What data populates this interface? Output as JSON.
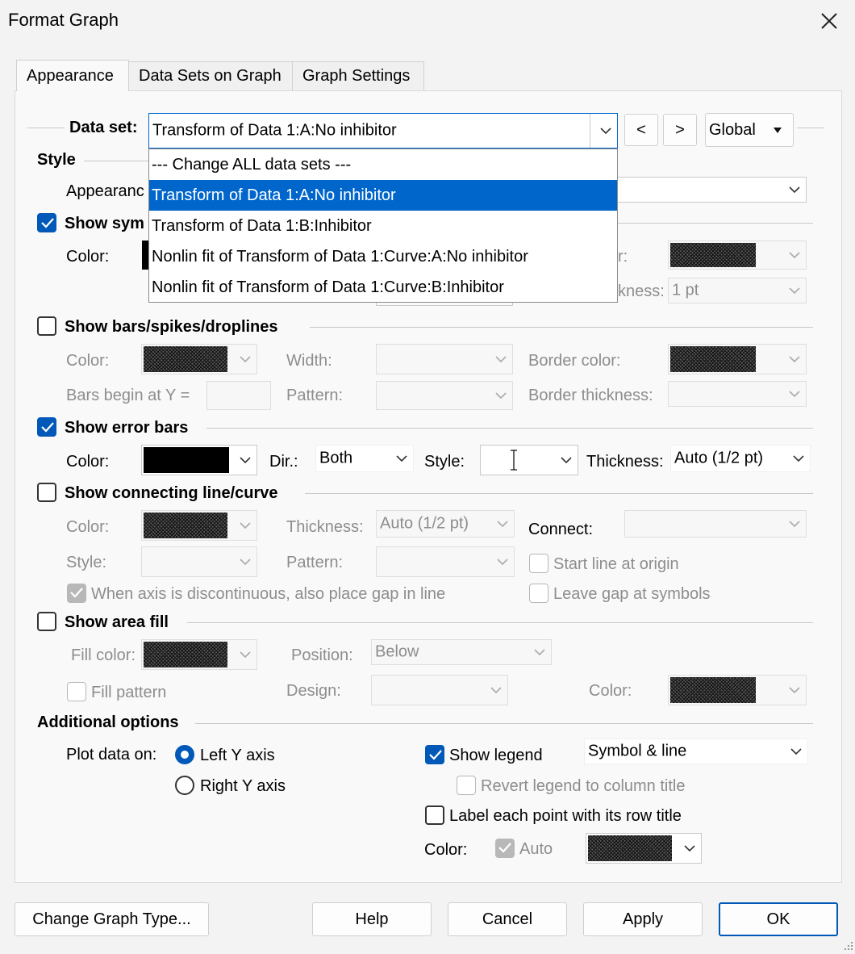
{
  "window": {
    "title": "Format Graph"
  },
  "tabs": [
    "Appearance",
    "Data Sets on Graph",
    "Graph Settings"
  ],
  "dataset": {
    "label": "Data set:",
    "value": "Transform of Data 1:A:No inhibitor",
    "prev": "<",
    "next": ">",
    "scope": "Global",
    "options": [
      "--- Change ALL data sets ---",
      "Transform of Data 1:A:No inhibitor",
      "Transform of Data 1:B:Inhibitor",
      "Nonlin fit of Transform of Data 1:Curve:A:No inhibitor",
      "Nonlin fit of Transform of Data 1:Curve:B:Inhibitor"
    ]
  },
  "style": {
    "header": "Style",
    "appearance_label": "Appearanc",
    "show_symbols": "Show sym",
    "color_label": "Color:",
    "border_color_partial": "r:",
    "thickness_partial": "kness:",
    "thickness_value": "1 pt"
  },
  "bars": {
    "label": "Show bars/spikes/droplines",
    "color": "Color:",
    "width": "Width:",
    "border_color": "Border color:",
    "begin": "Bars begin at Y =",
    "pattern": "Pattern:",
    "border_thickness": "Border thickness:"
  },
  "error_bars": {
    "label": "Show error bars",
    "color": "Color:",
    "dir_label": "Dir.:",
    "dir_value": "Both",
    "style_label": "Style:",
    "thickness_label": "Thickness:",
    "thickness_value": "Auto (1/2 pt)"
  },
  "line": {
    "label": "Show connecting line/curve",
    "color": "Color:",
    "thickness": "Thickness:",
    "thickness_value": "Auto (1/2 pt)",
    "connect": "Connect:",
    "style": "Style:",
    "pattern": "Pattern:",
    "start_origin": "Start line at origin",
    "gap_discontinuous": "When axis is discontinuous, also place gap in line",
    "gap_symbols": "Leave gap at symbols"
  },
  "area": {
    "label": "Show area fill",
    "fill_color": "Fill color:",
    "position": "Position:",
    "position_value": "Below",
    "fill_pattern": "Fill pattern",
    "design": "Design:",
    "color": "Color:"
  },
  "additional": {
    "header": "Additional options",
    "plot_on": "Plot data on:",
    "left_y": "Left Y axis",
    "right_y": "Right  Y axis",
    "show_legend": "Show legend",
    "legend_value": "Symbol & line",
    "revert_legend": "Revert legend to column title",
    "label_points": "Label each point with its row title",
    "color": "Color:",
    "auto": "Auto"
  },
  "buttons": {
    "change_type": "Change Graph Type...",
    "help": "Help",
    "cancel": "Cancel",
    "apply": "Apply",
    "ok": "OK"
  }
}
